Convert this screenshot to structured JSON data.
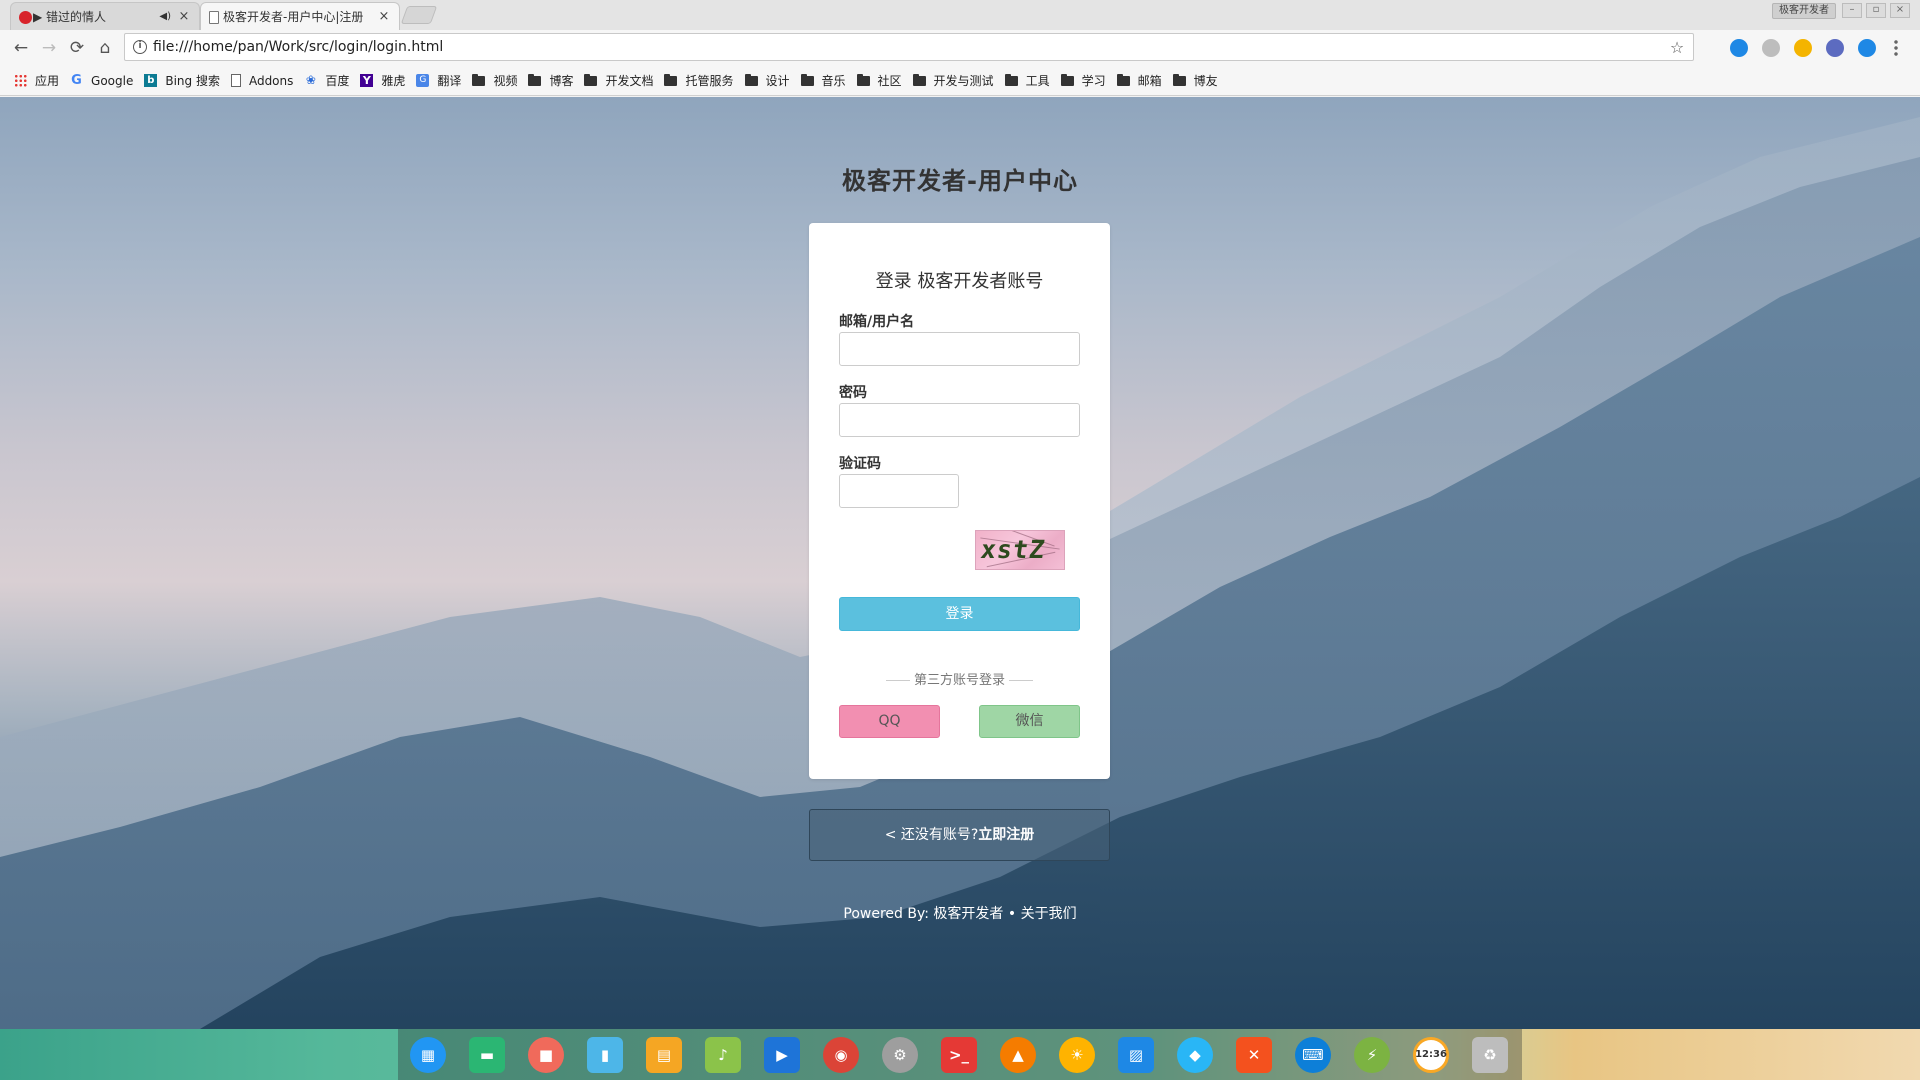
{
  "browser": {
    "tabs": [
      {
        "title": "▶ 错过的情人",
        "audio": "◀)",
        "favicon": "netease-music-icon",
        "active": false
      },
      {
        "title": "极客开发者-用户中心|注册",
        "favicon": "page-icon",
        "active": true
      }
    ],
    "close_glyph": "×",
    "profile_label": "极客开发者",
    "window_controls": [
      "–",
      "▫",
      "×"
    ],
    "nav": {
      "back": "←",
      "forward": "→",
      "reload": "⟳",
      "home": "⌂"
    },
    "url": "file:///home/pan/Work/src/login/login.html",
    "info_glyph": "i",
    "star_glyph": "☆",
    "extensions": [
      {
        "name": "translate-extension-icon",
        "color": "#1e88e5"
      },
      {
        "name": "broadcast-extension-icon",
        "color": "#bdbdbd"
      },
      {
        "name": "chrome-extension-icon",
        "color": "#f4b400"
      },
      {
        "name": "shield-extension-icon",
        "color": "#5c6bc0"
      },
      {
        "name": "vue-extension-icon",
        "color": "#1e88e5"
      },
      {
        "name": "menu-icon",
        "color": "#666666"
      }
    ],
    "bookmarks": [
      {
        "label": "应用",
        "icon": "apps-icon",
        "glyph": ""
      },
      {
        "label": "Google",
        "icon": "google-icon",
        "glyph": "G"
      },
      {
        "label": "Bing 搜索",
        "icon": "bing-icon",
        "glyph": "b"
      },
      {
        "label": "Addons",
        "icon": "document-icon",
        "glyph": ""
      },
      {
        "label": "百度",
        "icon": "baidu-paw-icon",
        "glyph": "❀"
      },
      {
        "label": "雅虎",
        "icon": "yahoo-icon",
        "glyph": "Y"
      },
      {
        "label": "翻译",
        "icon": "translate-icon",
        "glyph": "G"
      },
      {
        "label": "视频",
        "icon": "folder-icon",
        "glyph": ""
      },
      {
        "label": "博客",
        "icon": "folder-icon",
        "glyph": ""
      },
      {
        "label": "开发文档",
        "icon": "folder-icon",
        "glyph": ""
      },
      {
        "label": "托管服务",
        "icon": "folder-icon",
        "glyph": ""
      },
      {
        "label": "设计",
        "icon": "folder-icon",
        "glyph": ""
      },
      {
        "label": "音乐",
        "icon": "folder-icon",
        "glyph": ""
      },
      {
        "label": "社区",
        "icon": "folder-icon",
        "glyph": ""
      },
      {
        "label": "开发与测试",
        "icon": "folder-icon",
        "glyph": ""
      },
      {
        "label": "工具",
        "icon": "folder-icon",
        "glyph": ""
      },
      {
        "label": "学习",
        "icon": "folder-icon",
        "glyph": ""
      },
      {
        "label": "邮箱",
        "icon": "folder-icon",
        "glyph": ""
      },
      {
        "label": "博友",
        "icon": "folder-icon",
        "glyph": ""
      }
    ]
  },
  "page": {
    "site_title": "极客开发者-用户中心",
    "card_title": "登录 极客开发者账号",
    "username_label": "邮箱/用户名",
    "username_value": "",
    "password_label": "密码",
    "password_value": "",
    "captcha_label": "验证码",
    "captcha_value": "",
    "captcha_text": "xstZ",
    "login_button": "登录",
    "third_party_label": "第三方账号登录",
    "qq_button": "QQ",
    "wechat_button": "微信",
    "register_prefix": "< 还没有账号?",
    "register_link": "立即注册",
    "footer_prefix": "Powered By:",
    "footer_brand": "极客开发者",
    "footer_separator": " • ",
    "footer_about": "关于我们",
    "colors": {
      "login": "#5bc0de",
      "qq": "#f28fb1",
      "wechat": "#9fd6a5"
    }
  },
  "dock": {
    "apps": [
      {
        "name": "launcher-icon",
        "color": "#2196f3",
        "glyph": "▦",
        "shape": "circle"
      },
      {
        "name": "file-manager-icon",
        "color": "#2bb673",
        "glyph": "▬",
        "shape": "square"
      },
      {
        "name": "screen-recorder-icon",
        "color": "#f06a5b",
        "glyph": "■",
        "shape": "circle"
      },
      {
        "name": "archive-icon",
        "color": "#4db6e8",
        "glyph": "▮",
        "shape": "square"
      },
      {
        "name": "app-store-icon",
        "color": "#f5a623",
        "glyph": "▤",
        "shape": "square"
      },
      {
        "name": "music-player-icon",
        "color": "#8bc34a",
        "glyph": "♪",
        "shape": "square"
      },
      {
        "name": "video-player-icon",
        "color": "#1e74d8",
        "glyph": "▶",
        "shape": "square"
      },
      {
        "name": "chrome-icon",
        "color": "#db4437",
        "glyph": "◉",
        "shape": "circle"
      },
      {
        "name": "settings-icon",
        "color": "#9e9e9e",
        "glyph": "⚙",
        "shape": "circle"
      },
      {
        "name": "terminal-icon",
        "color": "#e53935",
        "glyph": ">_",
        "shape": "square"
      },
      {
        "name": "vlc-icon",
        "color": "#f57c00",
        "glyph": "▲",
        "shape": "circle"
      },
      {
        "name": "weather-icon",
        "color": "#ffb300",
        "glyph": "☀",
        "shape": "circle"
      },
      {
        "name": "system-monitor-icon",
        "color": "#1e88e5",
        "glyph": "▨",
        "shape": "square"
      },
      {
        "name": "wifi-icon",
        "color": "#29b6f6",
        "glyph": "◆",
        "shape": "circle"
      },
      {
        "name": "screenshot-tool-icon",
        "color": "#f4511e",
        "glyph": "✕",
        "shape": "square"
      },
      {
        "name": "keyboard-icon",
        "color": "#0d7fd8",
        "glyph": "⌨",
        "shape": "circle"
      },
      {
        "name": "power-icon",
        "color": "#7cb342",
        "glyph": "⚡",
        "shape": "circle"
      },
      {
        "name": "clock-icon",
        "color": "#f9a825",
        "glyph": "12:36",
        "shape": "circle"
      },
      {
        "name": "trash-icon",
        "color": "#bdbdbd",
        "glyph": "♻",
        "shape": "square"
      }
    ]
  }
}
